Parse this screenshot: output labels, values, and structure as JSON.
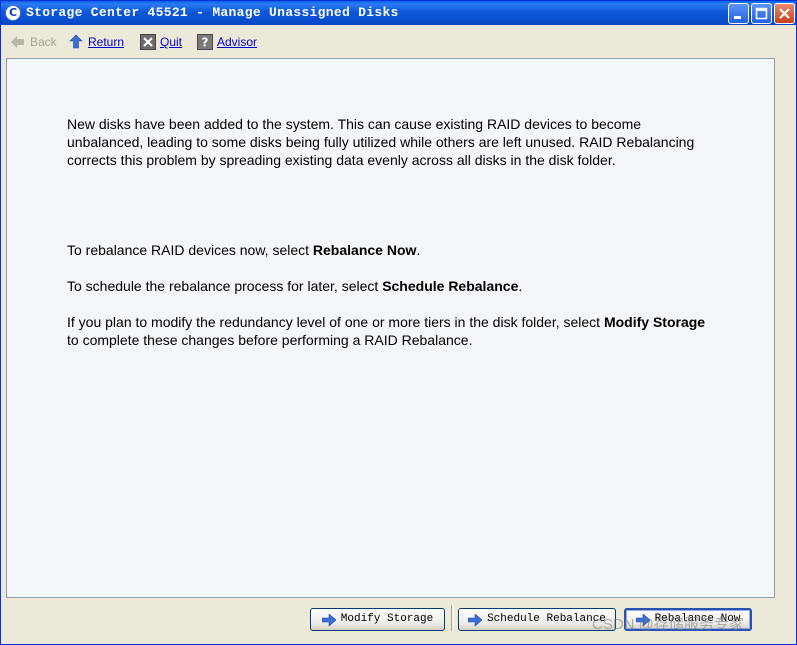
{
  "window": {
    "title": "Storage Center 45521 - Manage Unassigned Disks",
    "app_icon": "C"
  },
  "toolbar": {
    "back_label": "Back",
    "return_label": "Return",
    "quit_label": "Quit",
    "advisor_label": "Advisor"
  },
  "content": {
    "intro": "New disks have been added to the system. This can cause existing RAID devices to become unbalanced, leading to some disks being fully utilized while others are left unused. RAID Rebalancing corrects this problem by spreading existing data evenly across all disks in the disk folder.",
    "rebalance_now_prefix": "To rebalance RAID devices now, select ",
    "rebalance_now_bold": "Rebalance Now",
    "rebalance_now_suffix": ".",
    "schedule_prefix": "To schedule the rebalance process for later, select ",
    "schedule_bold": "Schedule Rebalance",
    "schedule_suffix": ".",
    "modify_prefix": "If you plan to modify the redundancy level of one or more tiers in the disk folder, select ",
    "modify_bold": "Modify Storage",
    "modify_suffix": " to complete these changes before performing a RAID Rebalance."
  },
  "buttons": {
    "modify_storage": "Modify Storage",
    "schedule_rebalance": "Schedule Rebalance",
    "rebalance_now": "Rebalance Now"
  },
  "watermark": "CSDN @存储服务专家",
  "colors": {
    "titlebar": "#0a4fd0",
    "content_bg": "#f3f6fa",
    "link": "#0000cc",
    "arrow": "#3a6fd8"
  }
}
